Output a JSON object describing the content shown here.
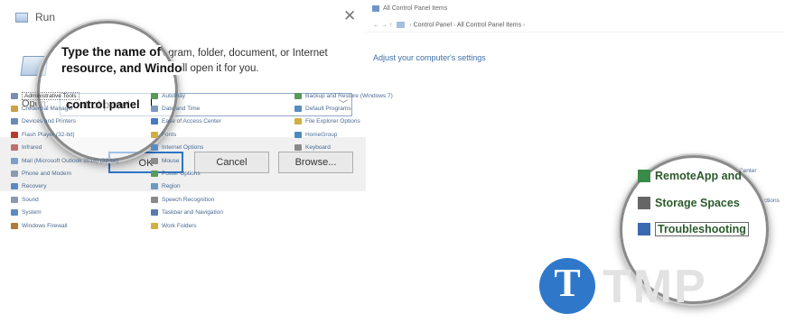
{
  "run_dialog": {
    "title": "Run",
    "close_glyph": "✕",
    "prompt_line1": "Type the name of a program, folder, document, or Internet",
    "prompt_line2": "resource, and Windows will open it for you.",
    "open_label": "Open:",
    "open_value": "control panel",
    "ok_label": "OK",
    "cancel_label": "Cancel",
    "browse_label": "Browse..."
  },
  "magnifier_left": {
    "prompt_line1": "Type the name of",
    "prompt_line2": "resource, and Windo",
    "open_value": "control panel"
  },
  "control_panel": {
    "title": "All Control Panel Items",
    "nav_arrows": "←  →  ↑",
    "breadcrumb": [
      "Control Panel",
      "All Control Panel Items"
    ],
    "heading": "Adjust your computer's settings",
    "columns": [
      [
        {
          "label": "Administrative Tools",
          "icon": "admin-tools-icon",
          "color": "#7a8fb0",
          "selected": true
        },
        {
          "label": "Credential Manager",
          "icon": "credential-icon",
          "color": "#c9a24a"
        },
        {
          "label": "Devices and Printers",
          "icon": "printer-icon",
          "color": "#6a8ab5"
        },
        {
          "label": "Flash Player (32-bit)",
          "icon": "flash-icon",
          "color": "#b83a2c"
        },
        {
          "label": "Infrared",
          "icon": "infrared-icon",
          "color": "#c07070"
        },
        {
          "label": "Mail (Microsoft Outlook 2016) (32-bit)",
          "icon": "mail-icon",
          "color": "#7aa0c8"
        },
        {
          "label": "Phone and Modem",
          "icon": "phone-icon",
          "color": "#8a9ab0"
        },
        {
          "label": "Recovery",
          "icon": "recovery-icon",
          "color": "#5a8ac0"
        },
        {
          "label": "Sound",
          "icon": "sound-icon",
          "color": "#8a9ab0"
        },
        {
          "label": "System",
          "icon": "system-icon",
          "color": "#5a8ac0"
        },
        {
          "label": "Windows Firewall",
          "icon": "firewall-icon",
          "color": "#b07a3a"
        }
      ],
      [
        {
          "label": "AutoPlay",
          "icon": "autoplay-icon",
          "color": "#5a9a5a"
        },
        {
          "label": "Date and Time",
          "icon": "clock-icon",
          "color": "#7a9ac0"
        },
        {
          "label": "Ease of Access Center",
          "icon": "ease-access-icon",
          "color": "#4a7ac0"
        },
        {
          "label": "Fonts",
          "icon": "fonts-icon",
          "color": "#d0b040"
        },
        {
          "label": "Internet Options",
          "icon": "internet-icon",
          "color": "#5a8ac0"
        },
        {
          "label": "Mouse",
          "icon": "mouse-icon",
          "color": "#8a8a8a"
        },
        {
          "label": "Power Options",
          "icon": "power-icon",
          "color": "#5a9a5a"
        },
        {
          "label": "Region",
          "icon": "region-icon",
          "color": "#6a9ac0"
        },
        {
          "label": "Speech Recognition",
          "icon": "microphone-icon",
          "color": "#8a8a8a"
        },
        {
          "label": "Taskbar and Navigation",
          "icon": "taskbar-icon",
          "color": "#5a7ab0"
        },
        {
          "label": "Work Folders",
          "icon": "folder-icon",
          "color": "#d0b040"
        }
      ],
      [
        {
          "label": "Backup and Restore (Windows 7)",
          "icon": "backup-icon",
          "color": "#5a9a5a"
        },
        {
          "label": "Default Programs",
          "icon": "default-programs-icon",
          "color": "#5a8ac0"
        },
        {
          "label": "File Explorer Options",
          "icon": "folder-options-icon",
          "color": "#d0b040"
        },
        {
          "label": "HomeGroup",
          "icon": "homegroup-icon",
          "color": "#4a8ac0"
        },
        {
          "label": "Keyboard",
          "icon": "keyboard-icon",
          "color": "#8a8a8a"
        }
      ]
    ],
    "partial_right_1": "Center",
    "partial_right_2": "nnections"
  },
  "magnifier_right": {
    "items": [
      {
        "label": "RemoteApp and",
        "icon": "remoteapp-icon",
        "color": "#3a8a4a"
      },
      {
        "label": "Storage Spaces",
        "icon": "storage-icon",
        "color": "#666666"
      },
      {
        "label": "Troubleshooting",
        "icon": "troubleshooting-icon",
        "color": "#3a6ab0"
      }
    ]
  },
  "watermark": {
    "logo_letter": "T",
    "text": "TMP"
  },
  "colors": {
    "accent_blue": "#2f78c9",
    "cp_link": "#4a6a92",
    "heading_blue": "#3e6ea8"
  }
}
